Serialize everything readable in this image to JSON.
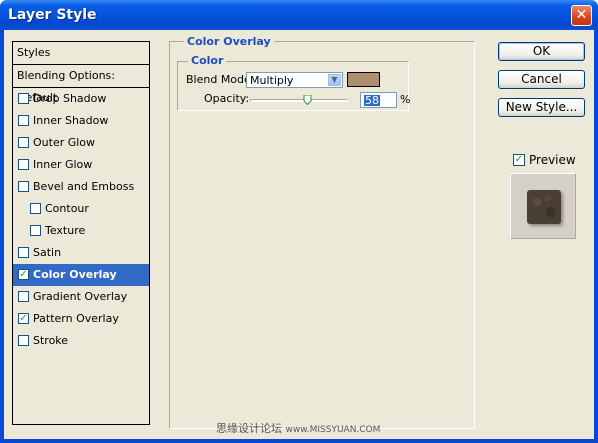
{
  "window": {
    "title": "Layer Style"
  },
  "icons": {
    "close": "close-icon",
    "dropdown": "chevron-down-icon",
    "checkmark": "checkmark-icon"
  },
  "styles_panel": {
    "header": "Styles",
    "blending_options": "Blending Options: Default",
    "items": [
      {
        "label": "Drop Shadow",
        "checked": false,
        "selected": false,
        "indent": false
      },
      {
        "label": "Inner Shadow",
        "checked": false,
        "selected": false,
        "indent": false
      },
      {
        "label": "Outer Glow",
        "checked": false,
        "selected": false,
        "indent": false
      },
      {
        "label": "Inner Glow",
        "checked": false,
        "selected": false,
        "indent": false
      },
      {
        "label": "Bevel and Emboss",
        "checked": false,
        "selected": false,
        "indent": false
      },
      {
        "label": "Contour",
        "checked": false,
        "selected": false,
        "indent": true
      },
      {
        "label": "Texture",
        "checked": false,
        "selected": false,
        "indent": true
      },
      {
        "label": "Satin",
        "checked": false,
        "selected": false,
        "indent": false
      },
      {
        "label": "Color Overlay",
        "checked": true,
        "selected": true,
        "indent": false
      },
      {
        "label": "Gradient Overlay",
        "checked": false,
        "selected": false,
        "indent": false
      },
      {
        "label": "Pattern Overlay",
        "checked": true,
        "selected": false,
        "indent": false
      },
      {
        "label": "Stroke",
        "checked": false,
        "selected": false,
        "indent": false
      }
    ]
  },
  "color_overlay": {
    "section_title": "Color Overlay",
    "group_title": "Color",
    "blend_mode_label": "Blend Mode:",
    "blend_mode_value": "Multiply",
    "swatch_color": "#ad8e6f",
    "opacity_label": "Opacity:",
    "opacity_value": "58",
    "opacity_unit": "%",
    "opacity_level": 0.58
  },
  "buttons": {
    "ok": "OK",
    "cancel": "Cancel",
    "new_style": "New Style..."
  },
  "preview": {
    "label": "Preview",
    "checked": true
  },
  "watermark": {
    "text": "思缘设计论坛",
    "url": "www.MISSYUAN.COM"
  },
  "colors": {
    "title_bar": "#0553df",
    "selection": "#316ac5",
    "dialog_bg": "#ece9d8",
    "group_title": "#1f4bbf"
  }
}
